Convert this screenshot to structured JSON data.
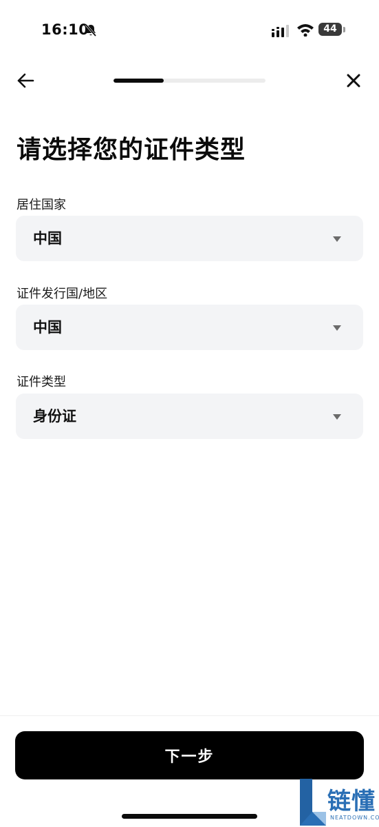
{
  "status_bar": {
    "time": "16:10",
    "battery": "44",
    "icons": [
      "bell-slash-icon",
      "signal-icon",
      "wifi-icon",
      "battery-icon"
    ]
  },
  "nav": {
    "back_icon": "arrow-left-icon",
    "close_icon": "close-icon",
    "progress": 0.33
  },
  "page": {
    "title": "请选择您的证件类型"
  },
  "fields": [
    {
      "label": "居住国家",
      "value": "中国"
    },
    {
      "label": "证件发行国/地区",
      "value": "中国"
    },
    {
      "label": "证件类型",
      "value": "身份证"
    }
  ],
  "footer": {
    "next_label": "下一步"
  },
  "watermark": {
    "text": "链懂",
    "subtext": "NEATDOWN.COM"
  },
  "colors": {
    "primary": "#000000",
    "field_bg": "#f3f4f6",
    "watermark": "#2a6fb5"
  }
}
